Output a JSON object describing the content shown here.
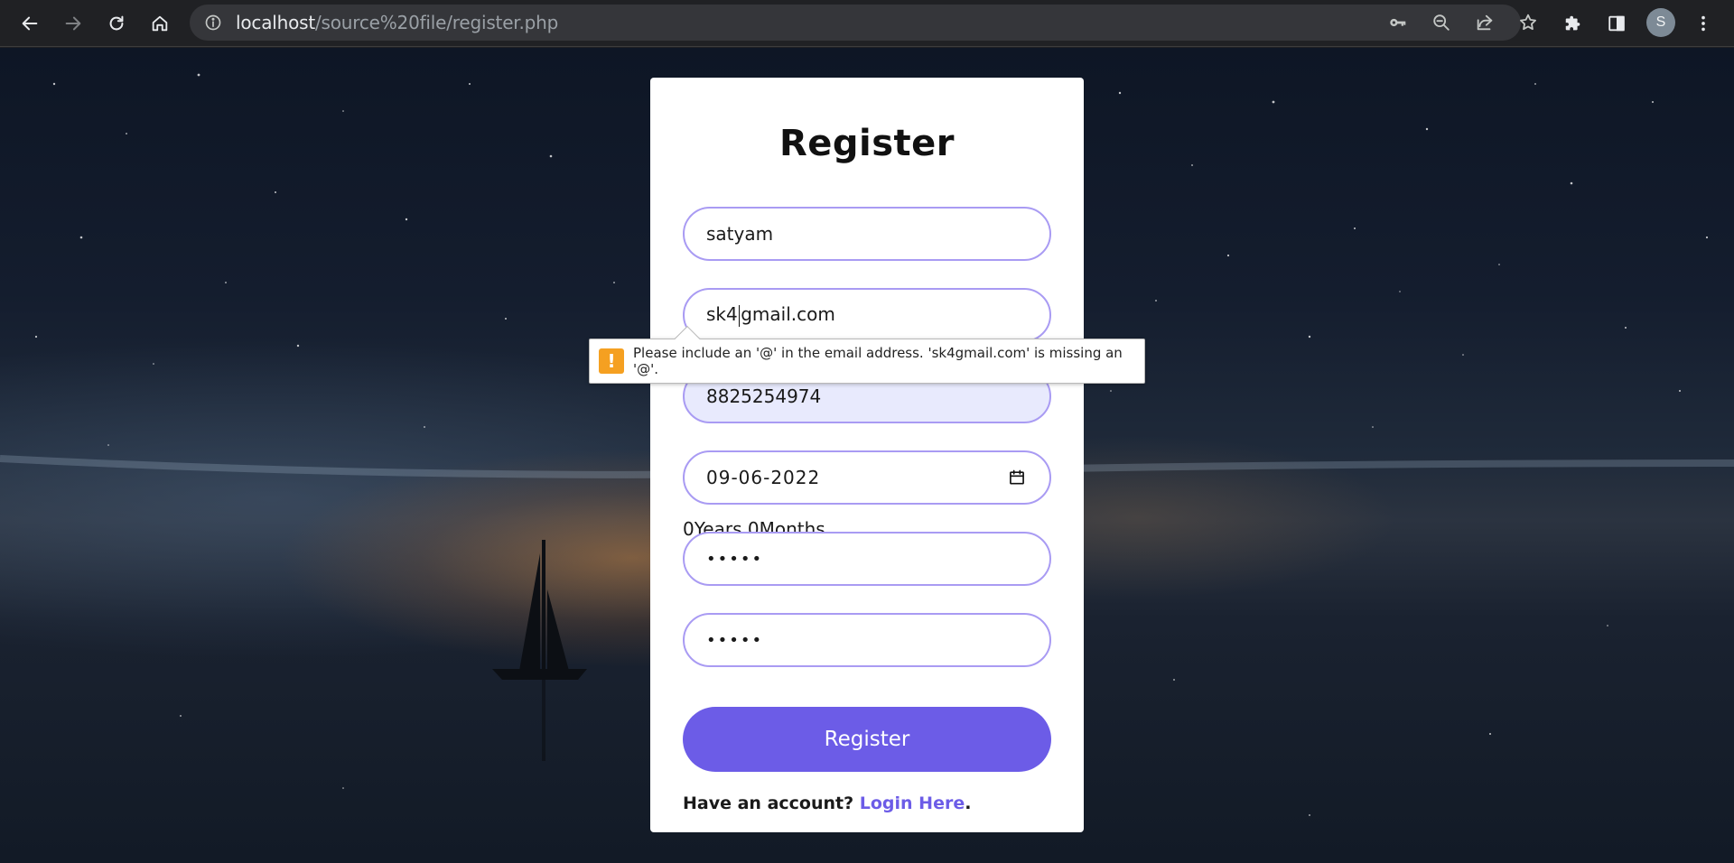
{
  "browser": {
    "url_host": "localhost",
    "url_path": "/source%20file/register.php",
    "profile_initial": "S",
    "icons": {
      "back": "arrow-left-icon",
      "forward": "arrow-right-icon",
      "reload": "reload-icon",
      "home": "home-icon",
      "info": "info-icon",
      "key": "key-icon",
      "zoom": "zoom-out-icon",
      "share": "share-icon",
      "bookmark": "star-icon",
      "extensions": "puzzle-icon",
      "side_panel": "side-panel-icon",
      "menu": "kebab-menu-icon"
    }
  },
  "form": {
    "title": "Register",
    "name_value": "satyam",
    "email_before_caret": "sk4",
    "email_after_caret": "gmail.com",
    "phone_value": "8825254974",
    "dob_value": "09-06-2022",
    "age_text": "0Years 0Months",
    "password_mask": "•••••",
    "confirm_password_mask": "•••••",
    "submit_label": "Register",
    "account_prompt": "Have an account?",
    "login_link": "Login Here",
    "account_suffix": "."
  },
  "validation": {
    "message": "Please include an '@' in the email address. 'sk4gmail.com' is missing an '@'.",
    "icon": "warning-icon",
    "icon_glyph": "!"
  },
  "colors": {
    "accent": "#6c5ce7",
    "field_border": "#a99bf3",
    "warning": "#f5a021",
    "chrome_bg": "#202124"
  }
}
